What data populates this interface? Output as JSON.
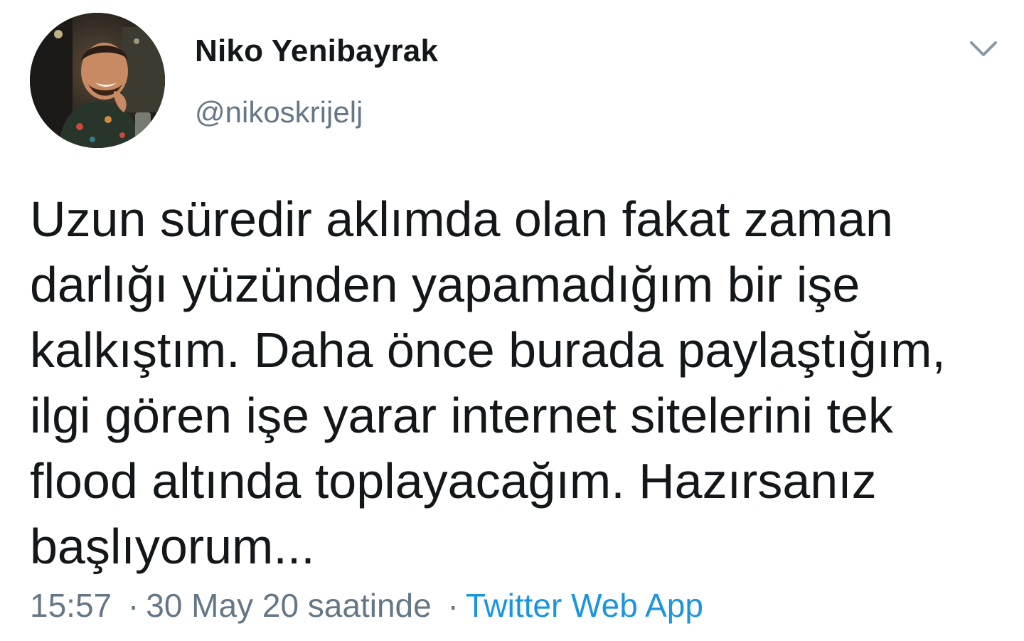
{
  "author": {
    "display_name": "Niko Yenibayrak",
    "handle": "@nikoskrijelj"
  },
  "icons": {
    "menu": "chevron-down-icon",
    "avatar": "profile-photo"
  },
  "tweet": {
    "text": "Uzun süredir aklımda olan fakat zaman darlığı yüzünden yapamadığım bir işe kalkıştım. Daha önce burada paylaştığım, ilgi gören işe yarar internet sitelerini tek flood altında toplayacağım. Hazırsanız başlıyorum...",
    "time": "15:57",
    "separator": "·",
    "date": "30 May 20 saatinde",
    "source": "Twitter Web App"
  },
  "colors": {
    "text": "#14171a",
    "secondary": "#657786",
    "link": "#1b95e0",
    "background": "#ffffff"
  }
}
